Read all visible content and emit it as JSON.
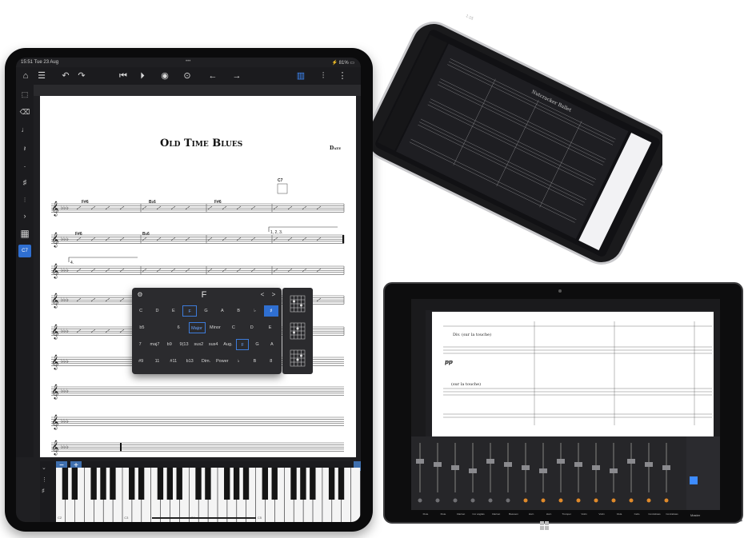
{
  "ipad": {
    "status_time": "15:51",
    "status_date": "Tue 23 Aug",
    "status_battery": "81%",
    "toolbar": {
      "icons": [
        "home-icon",
        "scores-icon",
        "undo-icon",
        "redo-icon",
        "rewind-icon",
        "play-icon",
        "record-icon",
        "metronome-icon",
        "back-icon",
        "forward-icon",
        "piano-icon",
        "mixer-icon",
        "more-icon"
      ]
    },
    "rail": {
      "chord_label": "C7"
    },
    "score": {
      "title": "Old Time Blues",
      "composer": "Date",
      "chords": [
        "F#6",
        "B♭6",
        "F#6",
        "C7",
        "F#6",
        "B♭6",
        "F"
      ],
      "volta_1": "1, 2, 3.",
      "volta_4": "4."
    },
    "chord_popup": {
      "root": "F",
      "roots": [
        "C",
        "D",
        "E",
        "F",
        "G",
        "A",
        "B",
        "♭",
        "♯"
      ],
      "row2": [
        "b5",
        "",
        "6",
        "Major",
        "Minor",
        "C",
        "D",
        "E"
      ],
      "row3": [
        "7",
        "maj7",
        "b9",
        "9(13",
        "sus2",
        "sus4",
        "Aug.",
        "F",
        "G",
        "A"
      ],
      "row4": [
        "#9",
        "11",
        "#11",
        "b13",
        "Dim.",
        "Power",
        "♭",
        "B",
        "8"
      ],
      "nav_prev": "<",
      "nav_next": ">"
    },
    "keyboard": {
      "minus": "−",
      "plus": "+",
      "octave_labels": [
        "C2",
        "C3",
        "C4",
        "C5"
      ]
    }
  },
  "phone": {
    "title": "Nutcracker Ballet",
    "status_time": "1:15"
  },
  "tablet": {
    "text_1": "Div. (sur la touche)",
    "text_2": "pp",
    "text_3": "(sur la touche)",
    "instruments": [
      "Flute",
      "Flute",
      "Clarinet",
      "Cor anglais",
      "Clarinet",
      "Bassoon",
      "Horn",
      "Horn",
      "Trumpet",
      "Violin",
      "Violin",
      "Viola",
      "Cello",
      "Contrabass",
      "Contrabass"
    ],
    "master_label": "Master"
  }
}
